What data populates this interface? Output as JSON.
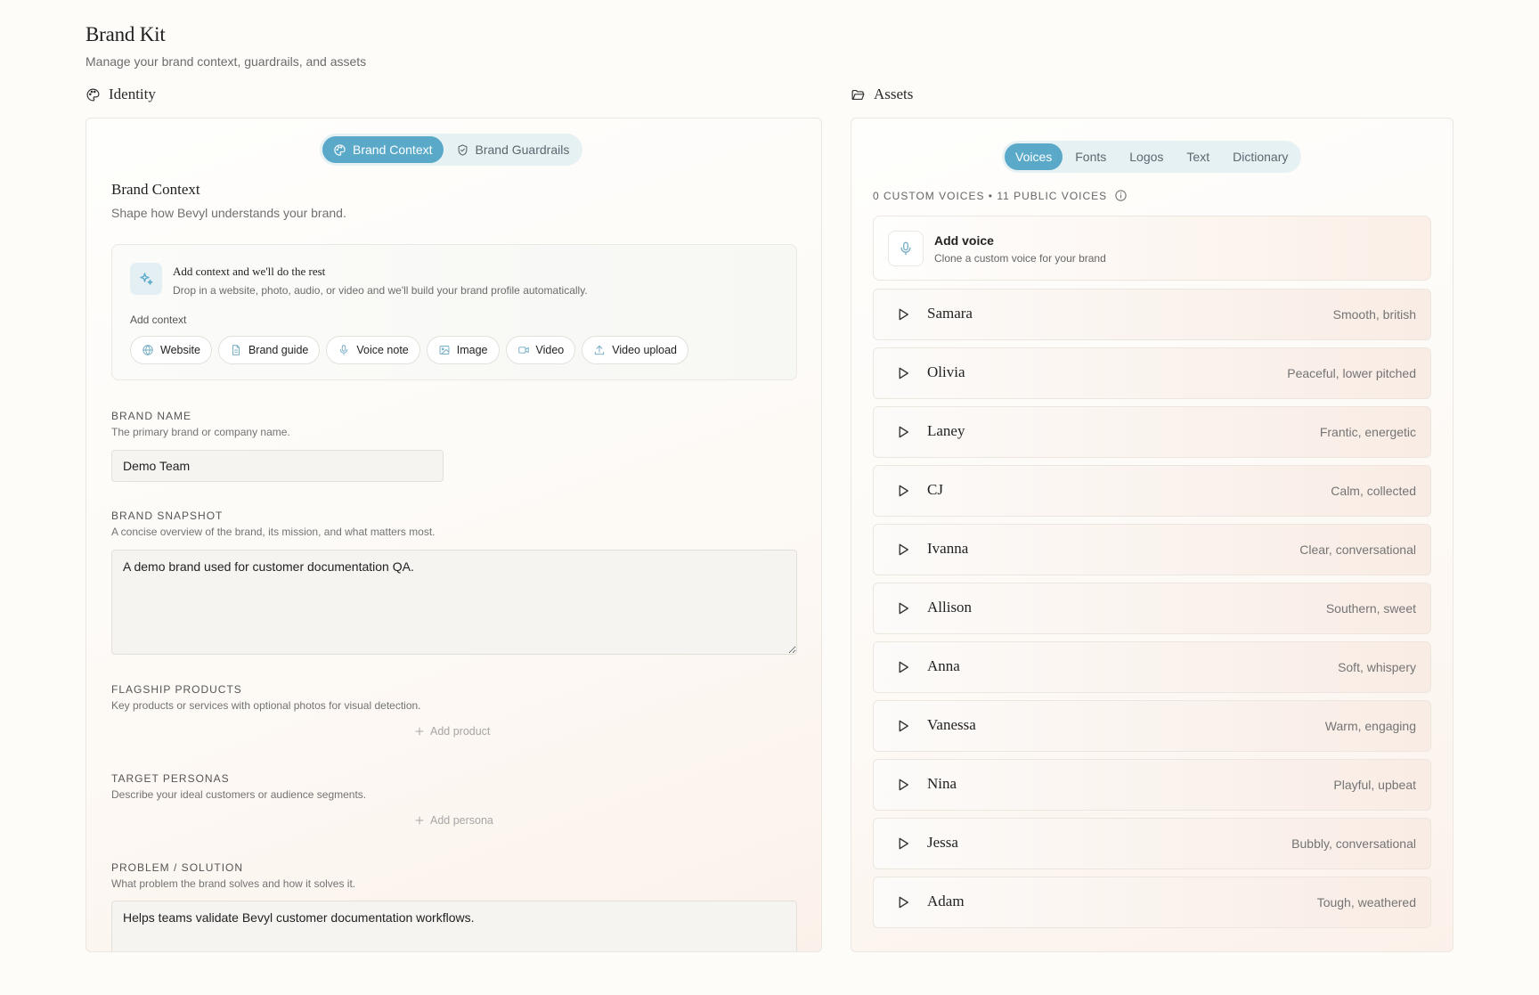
{
  "page": {
    "title": "Brand Kit",
    "subtitle": "Manage your brand context, guardrails, and assets"
  },
  "identity": {
    "label": "Identity",
    "tabs": [
      {
        "label": "Brand Context",
        "active": true,
        "icon": "palette-icon"
      },
      {
        "label": "Brand Guardrails",
        "active": false,
        "icon": "shield-icon"
      }
    ],
    "heading": "Brand Context",
    "subheading": "Shape how Bevyl understands your brand.",
    "add_context_card": {
      "title": "Add context and we'll do the rest",
      "description": "Drop in a website, photo, audio, or video and we'll build your brand profile automatically.",
      "label": "Add context",
      "chips": [
        {
          "label": "Website",
          "icon": "globe-icon"
        },
        {
          "label": "Brand guide",
          "icon": "document-icon"
        },
        {
          "label": "Voice note",
          "icon": "microphone-icon"
        },
        {
          "label": "Image",
          "icon": "image-icon"
        },
        {
          "label": "Video",
          "icon": "video-icon"
        },
        {
          "label": "Video upload",
          "icon": "upload-icon"
        }
      ]
    },
    "fields": {
      "brand_name": {
        "label": "BRAND NAME",
        "help": "The primary brand or company name.",
        "value": "Demo Team"
      },
      "brand_snapshot": {
        "label": "BRAND SNAPSHOT",
        "help": "A concise overview of the brand, its mission, and what matters most.",
        "value": "A demo brand used for customer documentation QA."
      },
      "flagship_products": {
        "label": "FLAGSHIP PRODUCTS",
        "help": "Key products or services with optional photos for visual detection.",
        "add_label": "Add product"
      },
      "target_personas": {
        "label": "TARGET PERSONAS",
        "help": "Describe your ideal customers or audience segments.",
        "add_label": "Add persona"
      },
      "problem_solution": {
        "label": "PROBLEM / SOLUTION",
        "help": "What problem the brand solves and how it solves it.",
        "value": "Helps teams validate Bevyl customer documentation workflows."
      }
    }
  },
  "assets": {
    "label": "Assets",
    "tabs": [
      {
        "label": "Voices",
        "active": true
      },
      {
        "label": "Fonts",
        "active": false
      },
      {
        "label": "Logos",
        "active": false
      },
      {
        "label": "Text",
        "active": false
      },
      {
        "label": "Dictionary",
        "active": false
      }
    ],
    "voice_count": "0 CUSTOM VOICES • 11 PUBLIC VOICES",
    "add_voice": {
      "title": "Add voice",
      "subtitle": "Clone a custom voice for your brand"
    },
    "voices": [
      {
        "name": "Samara",
        "description": "Smooth, british"
      },
      {
        "name": "Olivia",
        "description": "Peaceful, lower pitched"
      },
      {
        "name": "Laney",
        "description": "Frantic, energetic"
      },
      {
        "name": "CJ",
        "description": "Calm, collected"
      },
      {
        "name": "Ivanna",
        "description": "Clear, conversational"
      },
      {
        "name": "Allison",
        "description": "Southern, sweet"
      },
      {
        "name": "Anna",
        "description": "Soft, whispery"
      },
      {
        "name": "Vanessa",
        "description": "Warm, engaging"
      },
      {
        "name": "Nina",
        "description": "Playful, upbeat"
      },
      {
        "name": "Jessa",
        "description": "Bubbly, conversational"
      },
      {
        "name": "Adam",
        "description": "Tough, weathered"
      }
    ]
  },
  "colors": {
    "accent": "#5aa9c9",
    "tab_track": "#e6f1f4",
    "background": "#fdfcf9"
  }
}
